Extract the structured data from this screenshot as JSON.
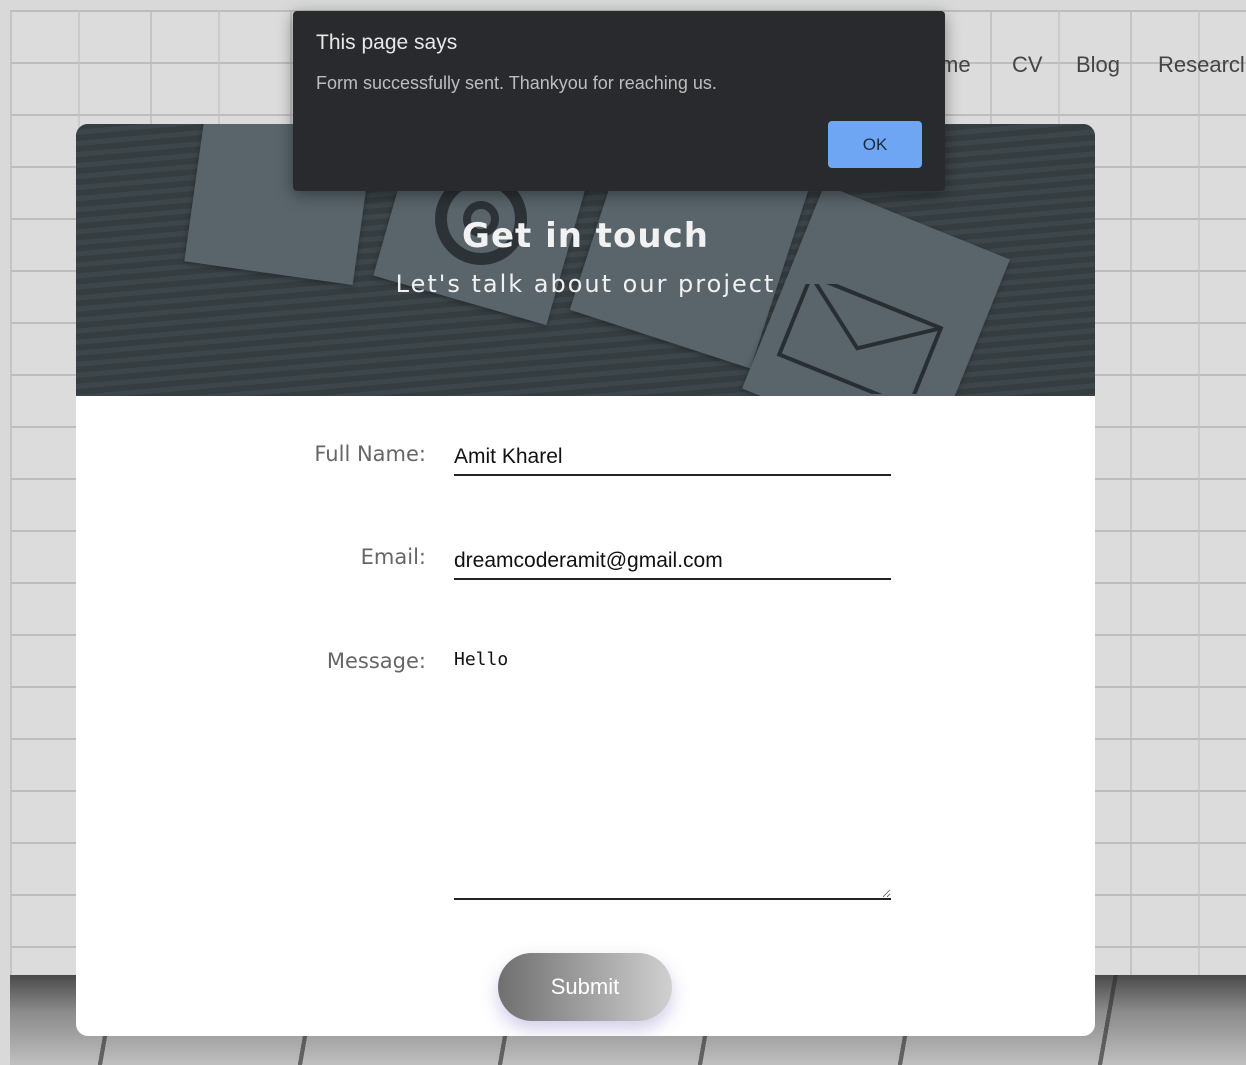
{
  "nav": {
    "items": [
      "me",
      "CV",
      "Blog",
      "Researcl"
    ]
  },
  "hero": {
    "title": "Get in touch",
    "subtitle": "Let's talk about our project"
  },
  "form": {
    "full_name_label": "Full Name:",
    "full_name_value": "Amit Kharel",
    "email_label": "Email:",
    "email_value": "dreamcoderamit@gmail.com",
    "message_label": "Message:",
    "message_value": "Hello",
    "submit_label": "Submit"
  },
  "dialog": {
    "title": "This page says",
    "message": "Form successfully sent. Thankyou for reaching us.",
    "ok_label": "OK"
  },
  "colors": {
    "dialog_bg": "#292a2d",
    "ok_button": "#6fa6f4",
    "card_bg": "#ffffff"
  }
}
